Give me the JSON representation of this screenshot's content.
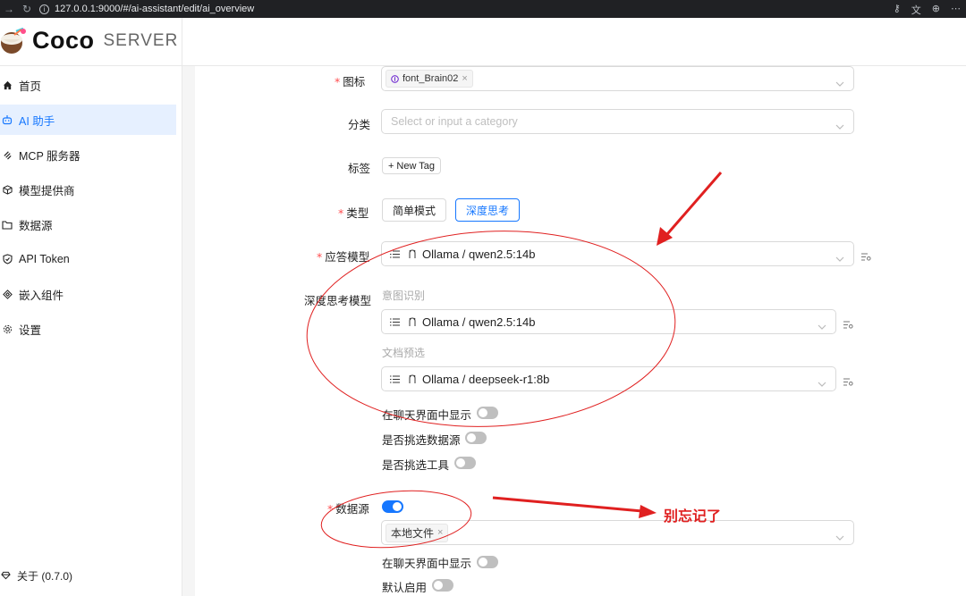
{
  "browser": {
    "url": "127.0.0.1:9000/#/ai-assistant/edit/ai_overview"
  },
  "app": {
    "title": "Coco",
    "subtitle": "SERVER"
  },
  "sidebar": {
    "items": [
      {
        "label": "首页",
        "icon": "home-icon"
      },
      {
        "label": "AI 助手",
        "icon": "robot-icon",
        "active": true
      },
      {
        "label": "MCP 服务器",
        "icon": "mcp-icon"
      },
      {
        "label": "模型提供商",
        "icon": "model-provider-icon"
      },
      {
        "label": "数据源",
        "icon": "folder-icon"
      },
      {
        "label": "API Token",
        "icon": "token-icon"
      },
      {
        "label": "嵌入组件",
        "icon": "embed-icon"
      },
      {
        "label": "设置",
        "icon": "gear-icon"
      }
    ],
    "footer": "关于 (0.7.0)"
  },
  "form": {
    "icon": {
      "label": "图标",
      "value": "font_Brain02"
    },
    "category": {
      "label": "分类",
      "placeholder": "Select or input a category"
    },
    "tags": {
      "label": "标签",
      "button": "+ New Tag"
    },
    "type": {
      "label": "类型",
      "options": [
        "简单模式",
        "深度思考"
      ],
      "selected": "深度思考"
    },
    "answer_model": {
      "label": "应答模型",
      "value": "Ollama / qwen2.5:14b"
    },
    "deep_model": {
      "label": "深度思考模型",
      "intent_label": "意图识别",
      "intent_value": "Ollama / qwen2.5:14b",
      "doc_label": "文档预选",
      "doc_value": "Ollama / deepseek-r1:8b"
    },
    "switches_1": [
      {
        "label": "在聊天界面中显示",
        "on": false
      },
      {
        "label": "是否挑选数据源",
        "on": false
      },
      {
        "label": "是否挑选工具",
        "on": false
      }
    ],
    "datasource": {
      "label": "数据源",
      "on": true,
      "tag": "本地文件"
    },
    "switches_2": [
      {
        "label": "在聊天界面中显示",
        "on": false
      },
      {
        "label": "默认启用",
        "on": false
      }
    ]
  },
  "annotation": {
    "note": "别忘记了",
    "color": "#e02020"
  },
  "colors": {
    "accent": "#1677ff",
    "required": "#ff4d4f"
  }
}
